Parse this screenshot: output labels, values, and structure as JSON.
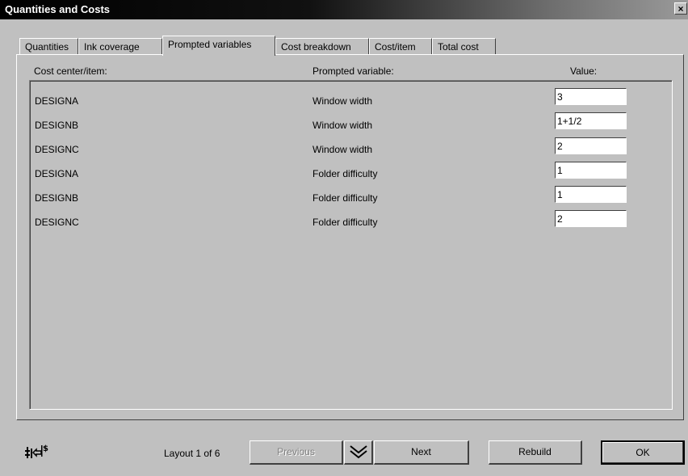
{
  "window": {
    "title": "Quantities and Costs",
    "close_glyph": "×"
  },
  "tabs": [
    {
      "label": "Quantities"
    },
    {
      "label": "Ink coverage"
    },
    {
      "label": "Prompted variables",
      "active": true
    },
    {
      "label": "Cost breakdown"
    },
    {
      "label": "Cost/item"
    },
    {
      "label": "Total cost"
    }
  ],
  "columns": {
    "item": "Cost center/item:",
    "variable": "Prompted variable:",
    "value": "Value:"
  },
  "rows": [
    {
      "item": "DESIGNA",
      "variable": "Window width",
      "value": "3"
    },
    {
      "item": "DESIGNB",
      "variable": "Window width",
      "value": "1+1/2"
    },
    {
      "item": "DESIGNC",
      "variable": "Window width",
      "value": "2"
    },
    {
      "item": "DESIGNA",
      "variable": "Folder difficulty",
      "value": "1"
    },
    {
      "item": "DESIGNB",
      "variable": "Folder difficulty",
      "value": "1"
    },
    {
      "item": "DESIGNC",
      "variable": "Folder difficulty",
      "value": "2"
    }
  ],
  "footer": {
    "layout_text": "Layout 1 of 6",
    "previous_label": "Previous",
    "next_label": "Next",
    "rebuild_label": "Rebuild",
    "ok_label": "OK",
    "calc_icon": "cost-calculator-icon",
    "chevron_icon": "double-chevron-down-icon"
  }
}
